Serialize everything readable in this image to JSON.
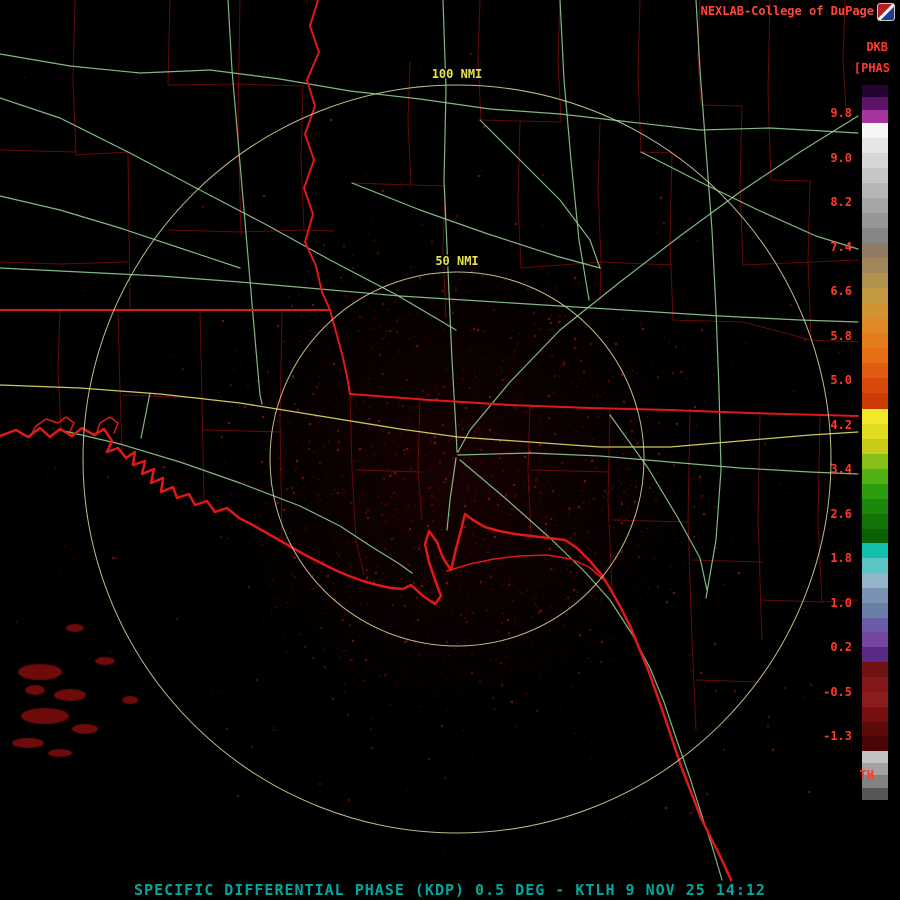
{
  "header": {
    "attribution": "NEXLAB-College of DuPage"
  },
  "colorbar": {
    "unit_top": "DKB",
    "unit_sub": "[PHAS",
    "threshold_label": "TH",
    "tick_labels": [
      "9.8",
      "9.0",
      "8.2",
      "7.4",
      "6.6",
      "5.8",
      "5.0",
      "4.2",
      "3.4",
      "2.6",
      "1.8",
      "1.0",
      "0.2",
      "-0.5",
      "-1.3"
    ],
    "segments": [
      {
        "h": 12,
        "c": "#240430"
      },
      {
        "h": 13,
        "c": "#5C1468"
      },
      {
        "h": 13,
        "c": "#A834A0"
      },
      {
        "h": 15,
        "c": "#F6F6F6"
      },
      {
        "h": 15,
        "c": "#E6E6E6"
      },
      {
        "h": 15,
        "c": "#D6D6D6"
      },
      {
        "h": 15,
        "c": "#C6C6C6"
      },
      {
        "h": 15,
        "c": "#B6B6B6"
      },
      {
        "h": 15,
        "c": "#A6A6A6"
      },
      {
        "h": 15,
        "c": "#969696"
      },
      {
        "h": 15,
        "c": "#868686"
      },
      {
        "h": 15,
        "c": "#8E7C64"
      },
      {
        "h": 15,
        "c": "#A08658"
      },
      {
        "h": 15,
        "c": "#B4924C"
      },
      {
        "h": 15,
        "c": "#C49A40"
      },
      {
        "h": 15,
        "c": "#D29232"
      },
      {
        "h": 15,
        "c": "#DE8826"
      },
      {
        "h": 15,
        "c": "#E47C1C"
      },
      {
        "h": 15,
        "c": "#E66E16"
      },
      {
        "h": 15,
        "c": "#E05C10"
      },
      {
        "h": 15,
        "c": "#D84A0C"
      },
      {
        "h": 16,
        "c": "#CC3A08"
      },
      {
        "h": 15,
        "c": "#F0E828"
      },
      {
        "h": 15,
        "c": "#E0DC20"
      },
      {
        "h": 15,
        "c": "#C8CC18"
      },
      {
        "h": 15,
        "c": "#84C018"
      },
      {
        "h": 15,
        "c": "#50B014"
      },
      {
        "h": 15,
        "c": "#2C9E0E"
      },
      {
        "h": 15,
        "c": "#1C880A"
      },
      {
        "h": 15,
        "c": "#127406"
      },
      {
        "h": 14,
        "c": "#0A6004"
      },
      {
        "h": 15,
        "c": "#12BEAC"
      },
      {
        "h": 15,
        "c": "#5CC4C4"
      },
      {
        "h": 15,
        "c": "#92B6C8"
      },
      {
        "h": 15,
        "c": "#7A92B2"
      },
      {
        "h": 15,
        "c": "#6A7EA6"
      },
      {
        "h": 14,
        "c": "#6A5CA8"
      },
      {
        "h": 15,
        "c": "#7446A2"
      },
      {
        "h": 15,
        "c": "#5A2A86"
      },
      {
        "h": 15,
        "c": "#701212"
      },
      {
        "h": 15,
        "c": "#841818"
      },
      {
        "h": 15,
        "c": "#8E1C1C"
      },
      {
        "h": 15,
        "c": "#761010"
      },
      {
        "h": 14,
        "c": "#5C0A0A"
      },
      {
        "h": 15,
        "c": "#4A0606"
      },
      {
        "h": 12,
        "c": "#C2C2C2"
      },
      {
        "h": 12,
        "c": "#A2A2A2"
      },
      {
        "h": 13,
        "c": "#828282"
      },
      {
        "h": 12,
        "c": "#565656"
      }
    ]
  },
  "map": {
    "range_rings": [
      {
        "label": "100 NMI"
      },
      {
        "label": "50 NMI"
      }
    ],
    "colors": {
      "county": "#6E0A0A",
      "road": "#8FCB8F",
      "highway": "#D8D060",
      "state_border": "#E01818",
      "coast": "#E01818",
      "ring": "#D2D29A",
      "ring_label": "#E8E44C",
      "echo_palette": [
        "#3F0404",
        "#5A0808",
        "#6E0A0A",
        "#8B1212"
      ]
    }
  },
  "statusbar": {
    "text": "SPECIFIC DIFFERENTIAL PHASE (KDP) 0.5 DEG - KTLH 9 NOV 25 14:12"
  }
}
